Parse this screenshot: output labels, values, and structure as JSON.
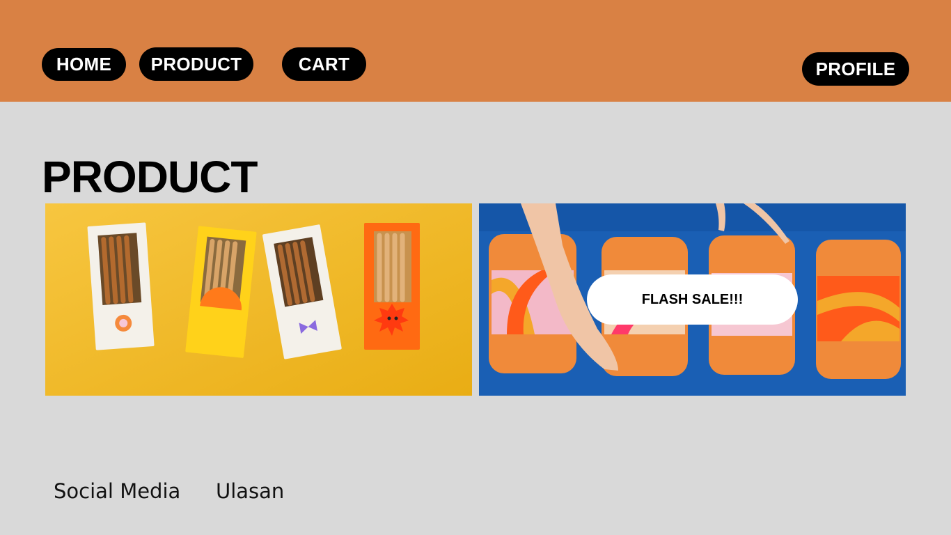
{
  "nav": {
    "home_label": "HOME",
    "product_label": "PRODUCT",
    "cart_label": "CART",
    "profile_label": "PROFILE"
  },
  "main": {
    "title": "PRODUCT",
    "flash_sale_label": "FLASH SALE!!!"
  },
  "footer": {
    "social_label": "Social Media",
    "review_label": "Ulasan"
  },
  "colors": {
    "header_bg": "#d98144",
    "page_bg": "#d9d9d9",
    "button_bg": "#000000",
    "image_left_bg": "#f5be1f",
    "image_right_bg": "#1a5fb4"
  }
}
